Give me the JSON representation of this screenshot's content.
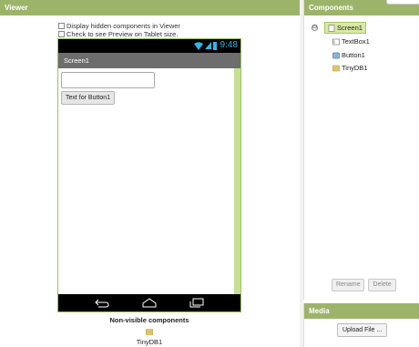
{
  "viewer": {
    "title": "Viewer",
    "show_hidden_label": "Display hidden components in Viewer",
    "tablet_preview_label": "Check to see Preview on Tablet size."
  },
  "phone": {
    "clock": "9:48",
    "screen_title": "Screen1",
    "button_text": "Text for Button1",
    "textbox_value": ""
  },
  "nonvisible": {
    "title": "Non-visible components",
    "items": [
      "TinyDB1"
    ]
  },
  "components": {
    "title": "Components",
    "root": "Screen1",
    "collapse_glyph": "⊟",
    "children": [
      "TextBox1",
      "Button1",
      "TinyDB1"
    ],
    "rename_label": "Rename",
    "delete_label": "Delete"
  },
  "media": {
    "title": "Media",
    "upload_label": "Upload File ..."
  },
  "colors": {
    "header_green": "#9cb46a",
    "phone_border": "#9cc15e",
    "selection": "#d9e8a6",
    "status_accent": "#33b5e5"
  },
  "icons": [
    "wifi-icon",
    "signal-icon",
    "battery-icon",
    "back-icon",
    "home-icon",
    "recent-apps-icon",
    "screen-icon",
    "textbox-icon",
    "button-icon",
    "tinydb-icon"
  ]
}
